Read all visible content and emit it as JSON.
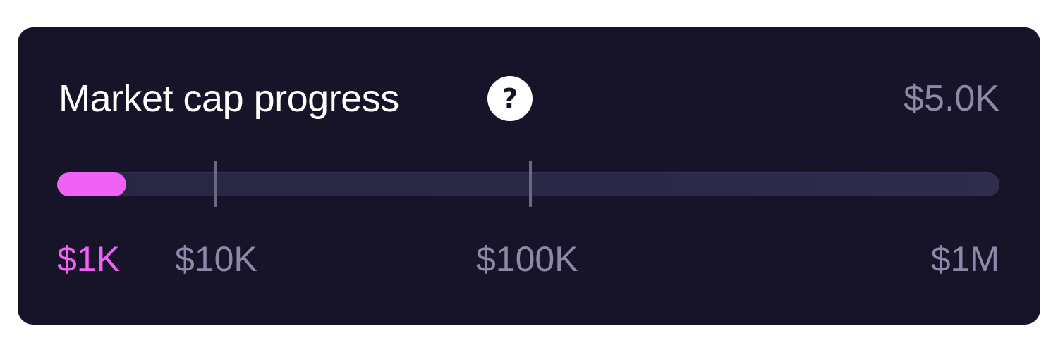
{
  "widget": {
    "title": "Market cap progress",
    "help_icon": "question-circle-icon",
    "help_glyph": "?",
    "current_value": "$5.0K",
    "progress_fraction": 0.073,
    "colors": {
      "background": "#17142a",
      "accent": "#f062f6",
      "muted_text": "#8c88a8",
      "title_text": "#ffffff"
    }
  },
  "scale": {
    "labels": [
      "$1K",
      "$10K",
      "$100K",
      "$1M"
    ],
    "active_label": "$1K"
  }
}
